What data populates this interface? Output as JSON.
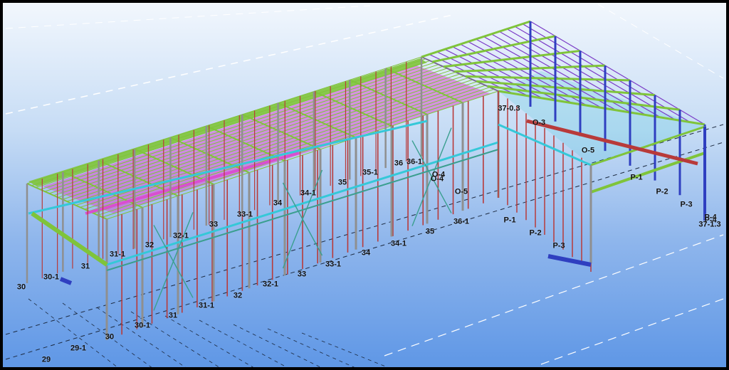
{
  "colors": {
    "sky_top": "#f2f7fd",
    "sky_mid": "#a9c9f1",
    "sky_bottom": "#5f97e6",
    "frame": "#000000",
    "column": "#b83a3a",
    "column_heavy": "#8f8f8f",
    "purlin": "#7fc43a",
    "roof_fill": "#d94fd0",
    "brace": "#3a9f8f",
    "blue_member": "#2f3fc0",
    "violet_member": "#7b3cc7",
    "cyan_beam": "#35c8d8",
    "grid_line": "#1c2a40",
    "label": "#111111"
  },
  "grid_labels": [
    {
      "text": "30"
    },
    {
      "text": "30-1"
    },
    {
      "text": "31"
    },
    {
      "text": "31-1"
    },
    {
      "text": "32"
    },
    {
      "text": "32-1"
    },
    {
      "text": "33"
    },
    {
      "text": "33-1"
    },
    {
      "text": "34"
    },
    {
      "text": "34-1"
    },
    {
      "text": "35"
    },
    {
      "text": "35-1"
    },
    {
      "text": "36"
    },
    {
      "text": "36-1"
    },
    {
      "text": "37-0.3"
    },
    {
      "text": "O-3"
    },
    {
      "text": "O-4"
    },
    {
      "text": "O-5"
    },
    {
      "text": "P-1"
    },
    {
      "text": "P-2"
    },
    {
      "text": "P-3"
    },
    {
      "text": "P-4"
    },
    {
      "text": "29"
    },
    {
      "text": "29-1"
    },
    {
      "text": "30"
    },
    {
      "text": "30-1"
    },
    {
      "text": "31"
    },
    {
      "text": "31-1"
    },
    {
      "text": "32"
    },
    {
      "text": "32-1"
    },
    {
      "text": "33"
    },
    {
      "text": "33-1"
    },
    {
      "text": "34"
    },
    {
      "text": "34-1"
    },
    {
      "text": "35"
    },
    {
      "text": "36-1"
    },
    {
      "text": "O-4"
    },
    {
      "text": "O-5"
    },
    {
      "text": "P-1"
    },
    {
      "text": "P-2"
    },
    {
      "text": "P-3"
    },
    {
      "text": "P-4"
    },
    {
      "text": "37-1.3"
    }
  ]
}
